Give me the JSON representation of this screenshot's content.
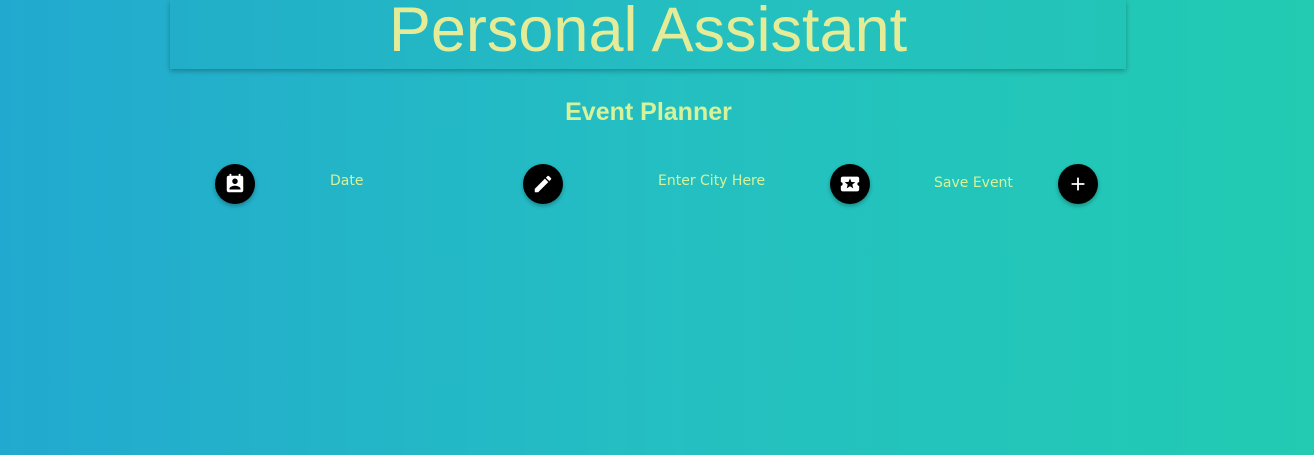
{
  "header": {
    "title": "Personal Assistant"
  },
  "planner": {
    "heading": "Event Planner",
    "date_field": {
      "placeholder": "Date",
      "value": ""
    },
    "city_field": {
      "placeholder": "Enter City Here",
      "value": ""
    },
    "save_label": "Save Event",
    "icons": {
      "date": "contact-calendar-icon",
      "edit": "pencil-icon",
      "event": "ticket-star-icon",
      "add": "plus-icon"
    }
  },
  "colors": {
    "title_text": "#e4ec98",
    "accent_text": "#d6f29a",
    "icon_background": "#000000",
    "background_start": "#22a9cf",
    "background_end": "#22cbb2"
  }
}
